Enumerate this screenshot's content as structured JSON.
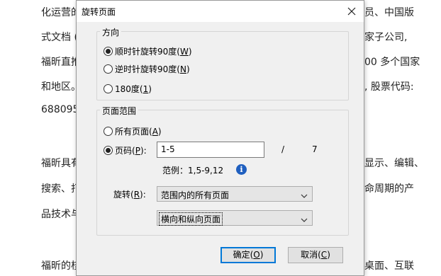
{
  "document": {
    "left_lines": [
      "化运营的",
      "式文档 (",
      "福昕直推",
      "和地区。",
      "688095",
      "福昕具有",
      "搜索、打",
      "品技术与",
      "福昕的核"
    ],
    "right_lines": [
      "员、中国版",
      "家子公司,",
      "00 多个国家",
      ", 股票代码:",
      "显示、编辑、",
      "命周期的产",
      "桌面、互联"
    ]
  },
  "dialog": {
    "title": "旋转页面",
    "close_icon": "close-icon",
    "direction": {
      "label": "方向",
      "options": [
        {
          "text": "顺时针旋转90度(",
          "key": "W",
          "end": ")",
          "checked": true
        },
        {
          "text": "逆时针旋转90度(",
          "key": "N",
          "end": ")",
          "checked": false
        },
        {
          "text": "180度(",
          "key": "1",
          "end": ")",
          "checked": false
        }
      ]
    },
    "range": {
      "label": "页面范围",
      "all_pages": {
        "text": "所有页面(",
        "key": "A",
        "end": ")",
        "checked": false
      },
      "pages": {
        "text": "页码(",
        "key": "P",
        "end": "):",
        "checked": true
      },
      "pages_value": "1-5",
      "slash": "/",
      "total": "7",
      "example": "范例：1,5-9,12",
      "info_icon": "info-icon",
      "rotate_label": {
        "text": "旋转(",
        "key": "R",
        "end": "):"
      },
      "rotate_select": "范围内的所有页面",
      "orient_select": "横向和纵向页面"
    },
    "ok": {
      "text": "确定(",
      "key": "O",
      "end": ")"
    },
    "cancel": {
      "text": "取消(",
      "key": "C",
      "end": ")"
    }
  }
}
